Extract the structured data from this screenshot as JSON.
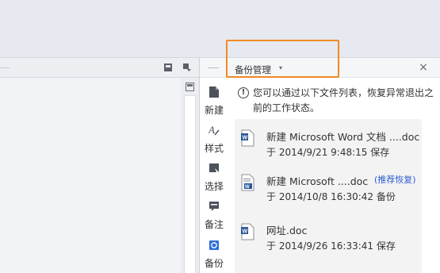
{
  "panel": {
    "title": "备份管理",
    "caret": "▾",
    "close": "×",
    "info": "您可以通过以下文件列表，恢复异常退出之前的工作状态。"
  },
  "side_tabs": [
    {
      "label": "新建",
      "icon": "new-file-icon"
    },
    {
      "label": "样式",
      "icon": "style-icon"
    },
    {
      "label": "选择",
      "icon": "select-icon"
    },
    {
      "label": "备注",
      "icon": "comment-icon"
    },
    {
      "label": "备份",
      "icon": "backup-icon"
    }
  ],
  "files": [
    {
      "name": "新建 Microsoft Word 文档 ....doc",
      "meta": "于 2014/9/21 9:48:15 保存",
      "badge": ""
    },
    {
      "name": "新建 Microsoft ....doc",
      "meta": "于 2014/10/8 16:30:42 备份",
      "badge": "(推荐恢复)"
    },
    {
      "name": "网址.doc",
      "meta": "于 2014/9/26 16:33:41 保存",
      "badge": ""
    }
  ],
  "colors": {
    "highlight": "#f08a24",
    "badge": "#2f5fd0",
    "doc_icon": "#2b5797"
  }
}
